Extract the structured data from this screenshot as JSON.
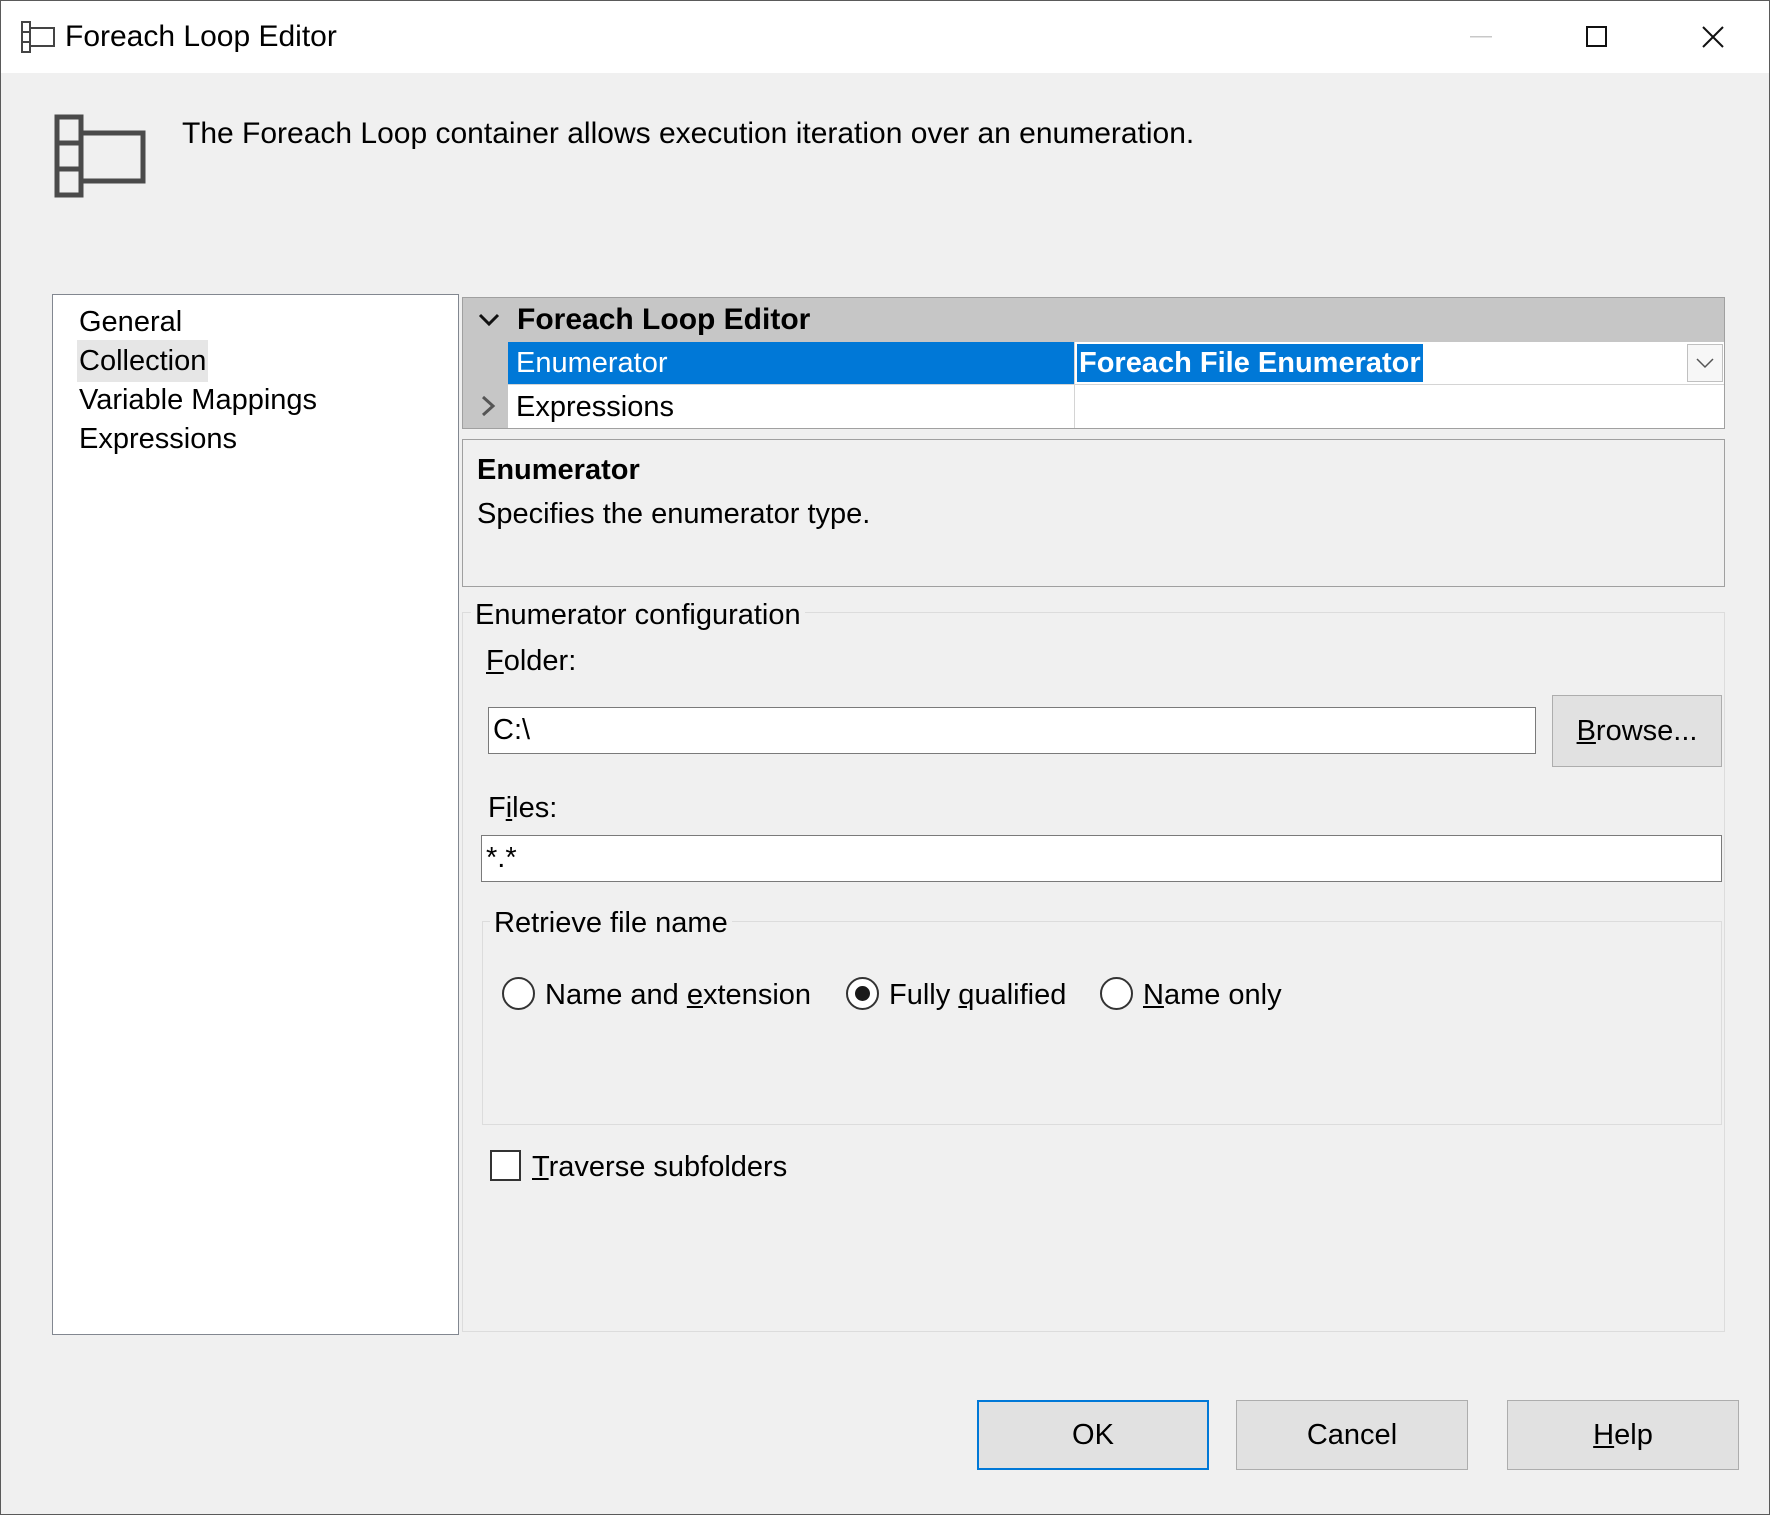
{
  "window": {
    "title": "Foreach Loop Editor",
    "icon": "foreach-loop-icon",
    "controls": [
      "minimize-icon",
      "maximize-icon",
      "close-icon"
    ]
  },
  "header": {
    "description": "The Foreach Loop container allows execution iteration over an enumeration.",
    "icon": "foreach-loop-icon"
  },
  "nav": {
    "items": [
      {
        "label": "General"
      },
      {
        "label": "Collection",
        "selected": true
      },
      {
        "label": "Variable Mappings"
      },
      {
        "label": "Expressions"
      }
    ]
  },
  "property_grid": {
    "category": "Foreach Loop Editor",
    "rows": [
      {
        "name": "Enumerator",
        "value": "Foreach File Enumerator",
        "selected": true
      },
      {
        "name": "Expressions",
        "value": ""
      }
    ]
  },
  "description_panel": {
    "title": "Enumerator",
    "text": "Specifies the enumerator type."
  },
  "config": {
    "legend": "Enumerator configuration",
    "folder_label_rest": "older:",
    "folder_label_accel": "F",
    "folder_value": "C:\\",
    "browse_accel": "B",
    "browse_rest": "rowse...",
    "files_label_pre": "F",
    "files_label_accel": "i",
    "files_label_rest": "les:",
    "files_value": "*.*",
    "retrieve": {
      "legend": "Retrieve file name",
      "options": [
        {
          "pre": "Name and ",
          "accel": "e",
          "post": "xtension",
          "checked": false
        },
        {
          "pre": "Fully ",
          "accel": "q",
          "post": "ualified",
          "checked": true
        },
        {
          "pre": "",
          "accel": "N",
          "post": "ame only",
          "checked": false
        }
      ]
    },
    "traverse": {
      "accel": "T",
      "rest": "raverse subfolders",
      "checked": false
    }
  },
  "buttons": {
    "ok": "OK",
    "cancel": "Cancel",
    "help_accel": "H",
    "help_rest": "elp"
  },
  "colors": {
    "selection": "#0078d7",
    "dialog_bg": "#f0f0f0",
    "grid_category": "#c6c6c6"
  }
}
